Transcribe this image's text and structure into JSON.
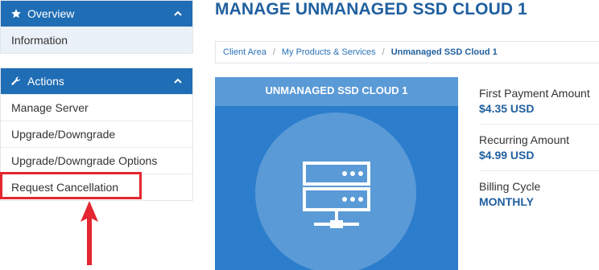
{
  "sidebar": {
    "overview": {
      "title": "Overview",
      "icon": "star-icon",
      "items": [
        {
          "label": "Information"
        }
      ]
    },
    "actions": {
      "title": "Actions",
      "icon": "wrench-icon",
      "items": [
        {
          "label": "Manage Server"
        },
        {
          "label": "Upgrade/Downgrade"
        },
        {
          "label": "Upgrade/Downgrade Options"
        },
        {
          "label": "Request Cancellation"
        }
      ]
    }
  },
  "main": {
    "title": "MANAGE UNMANAGED SSD CLOUD 1",
    "breadcrumb": [
      {
        "label": "Client Area"
      },
      {
        "label": "My Products & Services"
      },
      {
        "label": "Unmanaged SSD Cloud 1"
      }
    ],
    "product": {
      "name": "UNMANAGED SSD CLOUD 1",
      "icon": "server-icon"
    },
    "details": [
      {
        "label": "First Payment Amount",
        "value": "$4.35 USD"
      },
      {
        "label": "Recurring Amount",
        "value": "$4.99 USD"
      },
      {
        "label": "Billing Cycle",
        "value": "MONTHLY"
      }
    ]
  },
  "colors": {
    "primary": "#1f6db5",
    "card": "#2c7dcc",
    "highlight": "#e3262f",
    "link": "#2a72b8"
  }
}
